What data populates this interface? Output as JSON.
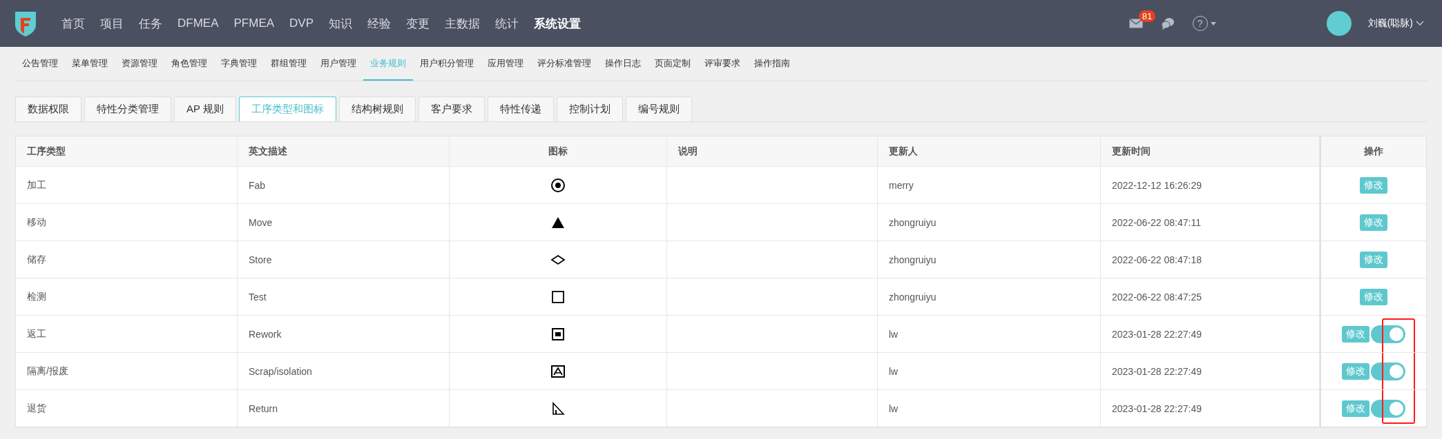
{
  "top_nav": {
    "items": [
      {
        "label": "首页",
        "selected": false
      },
      {
        "label": "项目",
        "selected": false
      },
      {
        "label": "任务",
        "selected": false
      },
      {
        "label": "DFMEA",
        "selected": false
      },
      {
        "label": "PFMEA",
        "selected": false
      },
      {
        "label": "DVP",
        "selected": false
      },
      {
        "label": "知识",
        "selected": false
      },
      {
        "label": "经验",
        "selected": false
      },
      {
        "label": "变更",
        "selected": false
      },
      {
        "label": "主数据",
        "selected": false
      },
      {
        "label": "统计",
        "selected": false
      },
      {
        "label": "系统设置",
        "selected": true
      }
    ],
    "mail_badge": "81",
    "help_label": "?",
    "user_name": "刘巍(聪脉)"
  },
  "sub_nav": [
    {
      "label": "公告管理",
      "selected": false
    },
    {
      "label": "菜单管理",
      "selected": false
    },
    {
      "label": "资源管理",
      "selected": false
    },
    {
      "label": "角色管理",
      "selected": false
    },
    {
      "label": "字典管理",
      "selected": false
    },
    {
      "label": "群组管理",
      "selected": false
    },
    {
      "label": "用户管理",
      "selected": false
    },
    {
      "label": "业务规则",
      "selected": true
    },
    {
      "label": "用户积分管理",
      "selected": false
    },
    {
      "label": "应用管理",
      "selected": false
    },
    {
      "label": "评分标准管理",
      "selected": false
    },
    {
      "label": "操作日志",
      "selected": false
    },
    {
      "label": "页面定制",
      "selected": false
    },
    {
      "label": "评审要求",
      "selected": false
    },
    {
      "label": "操作指南",
      "selected": false
    }
  ],
  "tabs": [
    {
      "label": "数据权限",
      "selected": false
    },
    {
      "label": "特性分类管理",
      "selected": false
    },
    {
      "label": "AP 规则",
      "selected": false
    },
    {
      "label": "工序类型和图标",
      "selected": true
    },
    {
      "label": "结构树规则",
      "selected": false
    },
    {
      "label": "客户要求",
      "selected": false
    },
    {
      "label": "特性传递",
      "selected": false
    },
    {
      "label": "控制计划",
      "selected": false
    },
    {
      "label": "编号规则",
      "selected": false
    }
  ],
  "table": {
    "columns": [
      "工序类型",
      "英文描述",
      "图标",
      "说明",
      "更新人",
      "更新时间",
      "操作"
    ],
    "toggles_highlighted": true,
    "rows": [
      {
        "type": "加工",
        "english": "Fab",
        "kind": "circle-dot",
        "updater": "merry",
        "updated": "2022-12-12 16:26:29",
        "action": "修改"
      },
      {
        "type": "移动",
        "english": "Move",
        "kind": "triangle",
        "updater": "zhongruiyu",
        "updated": "2022-06-22 08:47:11",
        "action": "修改"
      },
      {
        "type": "储存",
        "english": "Store",
        "kind": "diamond",
        "updater": "zhongruiyu",
        "updated": "2022-06-22 08:47:18",
        "action": "修改"
      },
      {
        "type": "检测",
        "english": "Test",
        "kind": "square",
        "updater": "zhongruiyu",
        "updated": "2022-06-22 08:47:25",
        "action": "修改"
      },
      {
        "type": "返工",
        "english": "Rework",
        "kind": "square-dot",
        "updater": "lw",
        "updated": "2023-01-28 22:27:49",
        "action": "修改",
        "toggle_on": true
      },
      {
        "type": "隔离/报废",
        "english": "Scrap/isolation",
        "kind": "boxed-triangle",
        "updater": "lw",
        "updated": "2023-01-28 22:27:49",
        "action": "修改",
        "toggle_on": true
      },
      {
        "type": "退货",
        "english": "Return",
        "kind": "right-triangle",
        "updater": "lw",
        "updated": "2023-01-28 22:27:49",
        "action": "修改",
        "toggle_on": true
      }
    ]
  }
}
